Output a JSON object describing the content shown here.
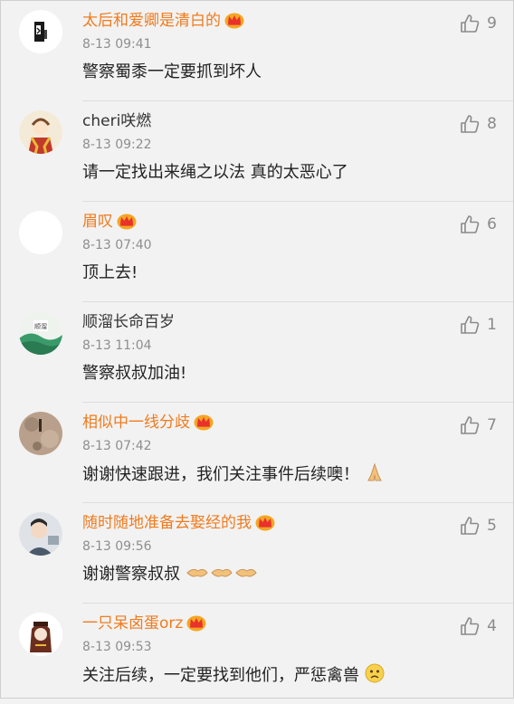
{
  "comments": [
    {
      "username": "太后和爱卿是清白的",
      "vip": true,
      "time": "8-13 09:41",
      "text": "警察蜀黍一定要抓到坏人",
      "likes": "9",
      "avatar": "ink-portrait",
      "emoji": null
    },
    {
      "username": "cheri咲燃",
      "vip": false,
      "time": "8-13 09:22",
      "text": "请一定找出来绳之以法 真的太恶心了",
      "likes": "8",
      "avatar": "scarf-cartoon",
      "emoji": null
    },
    {
      "username": "眉叹",
      "vip": true,
      "time": "8-13 07:40",
      "text": "顶上去!",
      "likes": "6",
      "avatar": "blank",
      "emoji": null
    },
    {
      "username": "顺溜长命百岁",
      "vip": false,
      "time": "8-13 11:04",
      "text": "警察叔叔加油!",
      "likes": "1",
      "avatar": "landscape",
      "emoji": null
    },
    {
      "username": "相似中一线分歧",
      "vip": true,
      "time": "8-13 07:42",
      "text": "谢谢快速跟进，我们关注事件后续噢！",
      "likes": "7",
      "avatar": "textured",
      "emoji": "pray-icon"
    },
    {
      "username": "随时随地准备去娶经的我",
      "vip": true,
      "time": "8-13 09:56",
      "text": "谢谢警察叔叔",
      "likes": "5",
      "avatar": "photo",
      "emoji": "handshake-icon"
    },
    {
      "username": "一只呆卤蛋orz",
      "vip": true,
      "time": "8-13 09:53",
      "text": "关注后续，一定要找到他们，严惩禽兽",
      "likes": "4",
      "avatar": "hooded-figure",
      "emoji": "sad-face-icon"
    }
  ],
  "colors": {
    "vip_name": "#f07b1e",
    "normal_name": "#333333",
    "time": "#8e8e8e",
    "like": "#8a8a8a"
  }
}
